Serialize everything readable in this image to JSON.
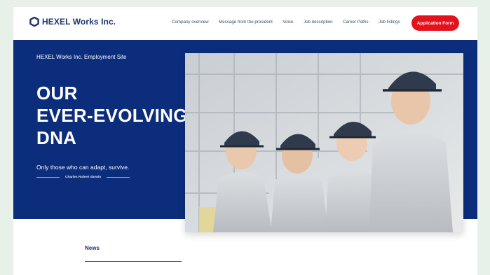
{
  "header": {
    "company_name": "HEXEL Works Inc.",
    "nav": [
      "Company overview",
      "Message from the president",
      "Voice",
      "Job description",
      "Career Paths",
      "Job listings"
    ],
    "apply_label": "Application Form",
    "accent_color": "#e4121c",
    "brand_color": "#1d3470"
  },
  "hero": {
    "site_label": "HEXEL Works Inc. Employment Site",
    "headline_lines": [
      "OUR",
      "EVER-EVOLVING",
      "DNA"
    ],
    "tagline": "Only those who can adapt, survive.",
    "quote_author": "Charles Robert darwin",
    "background_color": "#0c2d7c"
  },
  "news": {
    "label": "News"
  }
}
